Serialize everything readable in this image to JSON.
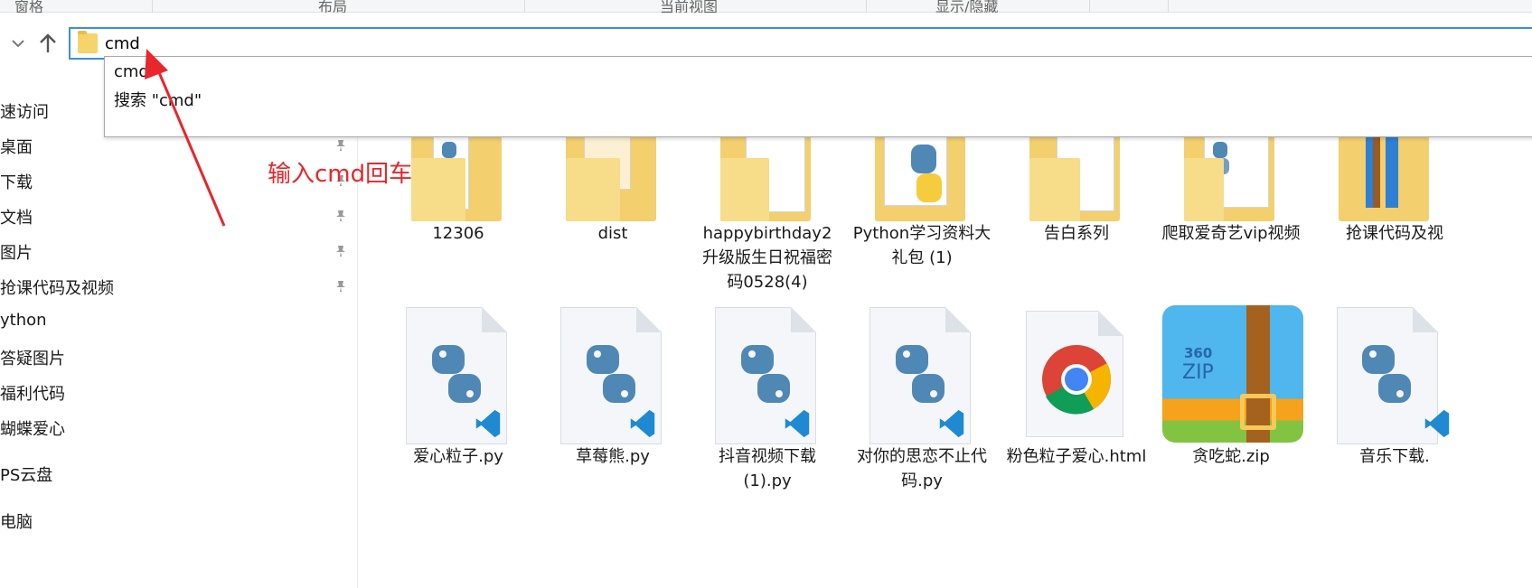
{
  "ribbon": {
    "groups": [
      "窗格",
      "布局",
      "当前视图",
      "显示/隐藏"
    ]
  },
  "address_bar": {
    "value": "cmd"
  },
  "autocomplete": {
    "options": [
      "cmd",
      "搜索 \"cmd\""
    ]
  },
  "sidebar": {
    "items": [
      {
        "label": "速访问",
        "pinned": false
      },
      {
        "label": "桌面",
        "pinned": true
      },
      {
        "label": "下载",
        "pinned": true
      },
      {
        "label": "文档",
        "pinned": true
      },
      {
        "label": "图片",
        "pinned": true
      },
      {
        "label": "抢课代码及视频",
        "pinned": true
      },
      {
        "label": "ython",
        "pinned": false
      },
      {
        "label": "答疑图片",
        "pinned": false
      },
      {
        "label": "福利代码",
        "pinned": false
      },
      {
        "label": "蝴蝶爱心",
        "pinned": false
      },
      {
        "label": "PS云盘",
        "pinned": false
      },
      {
        "label": "电脑",
        "pinned": false
      }
    ]
  },
  "folders": [
    {
      "name": "12306",
      "icon": "folder-vscode-icon"
    },
    {
      "name": "dist",
      "icon": "folder-icon"
    },
    {
      "name": "happybirthday2升级版生日祝福密码0528(4)",
      "icon": "folder-docs-icon"
    },
    {
      "name": "Python学习资料大礼包 (1)",
      "icon": "folder-python-icon"
    },
    {
      "name": "告白系列",
      "icon": "folder-docs-icon"
    },
    {
      "name": "爬取爱奇艺vip视频",
      "icon": "folder-vscode-icon"
    },
    {
      "name": "抢课代码及视",
      "icon": "folder-archive-icon"
    }
  ],
  "files": [
    {
      "name": "爱心粒子.py",
      "icon": "python-vscode-file-icon"
    },
    {
      "name": "草莓熊.py",
      "icon": "python-vscode-file-icon"
    },
    {
      "name": "抖音视频下载(1).py",
      "icon": "python-vscode-file-icon"
    },
    {
      "name": "对你的思恋不止代码.py",
      "icon": "python-vscode-file-icon"
    },
    {
      "name": "粉色粒子爱心.html",
      "icon": "chrome-html-file-icon"
    },
    {
      "name": "贪吃蛇.zip",
      "icon": "360zip-archive-icon"
    },
    {
      "name": "音乐下载.",
      "icon": "python-vscode-file-icon"
    }
  ],
  "zip_badge": {
    "brand": "360",
    "kind": "ZIP"
  },
  "annotation": {
    "text": "输入cmd回车",
    "color": "#e8262b"
  },
  "colors": {
    "accent": "#3b8fe0",
    "folder": "#f3cf6e",
    "python_blue": "#4f88b5",
    "python_yellow": "#f5cc3c"
  }
}
